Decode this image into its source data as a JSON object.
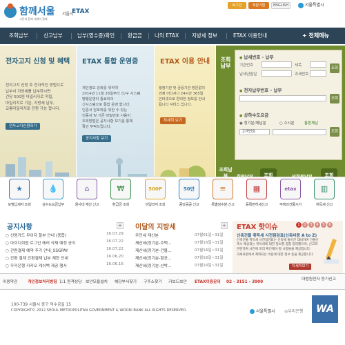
{
  "header": {
    "logo_text": "함께서울",
    "logo_subtitle": "시민과 함께 세계의 함께",
    "logo_seoul": "서울시",
    "logo_etax": "ETAX",
    "login": "로그인",
    "join": "회원가입",
    "english": "ENGLISH",
    "seoul_logo": "서울특별시"
  },
  "nav": {
    "items": [
      "조회납부",
      "신고납부",
      "납부(영수증)확인",
      "환급금",
      "나의 ETAX",
      "지방세 정보",
      "ETAX 이용안내"
    ],
    "all_menu": "+ 전체메뉴"
  },
  "panels": {
    "e_notice": {
      "title": "전자고지 신청 및 혜택",
      "desc": "전자고지 신청 후 전자적인 방법으로\n납부서 지방세를 납부하시면\n건당 500원 마일리지로 적립,\n마일리지로 기분, 지방세 납부,\n교통마일리지로 전환 가능 합니다.",
      "button": "전자고지신청하기"
    },
    "etax_integration": {
      "title": "ETAX 통합 운영중",
      "desc": "개인정보 강화를 위하여\n2014년 11월 26일부터 신/구 시스템\n병행운영이 종료되어\n신시스템으로 통합 운영 합니다.\n인증서 암호화를 위한 수 있는\n인증서 및 기존 비밀번호 사용이\n조회방법은 공지사항 보기를 통해\n확인 부탁드립니다.",
      "button": "공지사항 보기"
    },
    "guide": {
      "title": "ETAX 이용 안내",
      "desc": "행정기관 및 금융기관 방문없이\n언제 어디서나 24시간 365일\n인터넷으로 편리한 정보를 안내\n됩니다 서비스 입니다.",
      "button": "자세히 보기"
    }
  },
  "taxbox": {
    "side_label": "조회납부",
    "section1": "납세번호 - 납부",
    "field_org": "기관번호",
    "field_item": "세목",
    "field_year": "납세년월일",
    "field_class": "과세번호",
    "section2": "전자납부번호 - 납부",
    "section3": "상하수도요금",
    "radio1": "정기분/체납분",
    "radio2": "수시분",
    "radio3": "통합체납",
    "field_customer": "고객번호",
    "lookup": "조회",
    "bottom_side_label": "조회납부",
    "member_pay": "회원납부",
    "nonmember_pay": "비회원납부",
    "member_btn": "조회",
    "nonmember_btn": "조회"
  },
  "quick_icons": [
    {
      "label": "모범납세자 조회",
      "icon": "medal-icon",
      "glyph": "★",
      "color": "#3a77b8"
    },
    {
      "label": "상수도요금납부",
      "icon": "water-icon",
      "glyph": "💧",
      "color": "#2a9fd0"
    },
    {
      "label": "원사대 재산 신고",
      "icon": "house-icon",
      "glyph": "⌂",
      "color": "#7a5ca8"
    },
    {
      "label": "환급금 조회",
      "icon": "money-icon",
      "glyph": "₩",
      "color": "#3b8f49"
    },
    {
      "label": "마일리지 조회",
      "icon": "mileage-icon",
      "glyph": "500P",
      "color": "#d9a520"
    },
    {
      "label": "중앙공공 신고",
      "icon": "global-icon",
      "glyph": "50만",
      "color": "#2a7fc0"
    },
    {
      "label": "특별징수분 신고",
      "icon": "document-icon",
      "glyph": "≡",
      "color": "#d07a2a"
    },
    {
      "label": "등록면허세신고",
      "icon": "license-icon",
      "glyph": "▦",
      "color": "#c23b3b"
    },
    {
      "label": "주택외건물시가",
      "icon": "etax-icon",
      "glyph": "etax",
      "color": "#8a5aa0"
    },
    {
      "label": "취득세 신고",
      "icon": "building-icon",
      "glyph": "▥",
      "color": "#3a8f6a"
    }
  ],
  "notice": {
    "title": "공지사항",
    "items": [
      {
        "text": "신용카드 무이자 할부 안내 (종합)",
        "date": "16.07.29"
      },
      {
        "text": "아이디회원 로그인 에러 삭제 예정 공지",
        "date": "16.07.22"
      },
      {
        "text": "간편결제 예약 추가 안내_SSGPAY",
        "date": "16.07.22"
      },
      {
        "text": "간편 결제 간편결제 납부 제한 안내",
        "date": "16.06.20"
      },
      {
        "text": "우리은행 카카오 캐쉬백 제공 행사",
        "date": "16.06.16"
      }
    ]
  },
  "monthly": {
    "title": "이달의 지방세",
    "items": [
      {
        "text": "주민세 재산분",
        "date": "07월01일~31일"
      },
      {
        "text": "재산세(정기분-주택...",
        "date": "07월16일~31일"
      },
      {
        "text": "재산세(정기분-건물...",
        "date": "07월16일~31일"
      },
      {
        "text": "재산세(정기분-항공...",
        "date": "07월16일~31일"
      },
      {
        "text": "재산세(정기분-선박...",
        "date": "07월16일~31일"
      }
    ]
  },
  "hot": {
    "title": "ETAX 핫이슈",
    "pages": [
      "1",
      "2",
      "3",
      "4",
      "5",
      "6"
    ],
    "headline": "신축건물 취득세 사전점검표(신축비용 A to Z)",
    "body": "신축건물 취득세 사전점검표는 신축에 들어간 대비하여 건물신축시 예상되는 취득세에 대한 정보를 종합 정리했으며, 신고와 관련하여 사전에 미리 확인해야 할 사항들을 제공합니다.",
    "body2": "과세표준에서 제외되는 비용에 대한 정보 등을 제공합니다.",
    "button": "자세히보기"
  },
  "footer_links": [
    "이용약관",
    "개인정보처리방침",
    "1:1 원격상담",
    "보안모듈설치",
    "해당부서찾기",
    "구주소찾기",
    "키보드보안",
    "ETAX이용문의",
    "02 - 3151 - 3900",
    "대법원전자 등기신고"
  ],
  "footer": {
    "address": "100-739 서울시 중구 덕수궁길 15",
    "copyright": "COPYRIGHT© 2012 SEOUL METROPOLITAN GOVERNMENT & WOORI BANK ALL RIGHTS RESERVED.",
    "seoul": "서울특별시",
    "woori": "우리은행",
    "wa": "WA"
  }
}
